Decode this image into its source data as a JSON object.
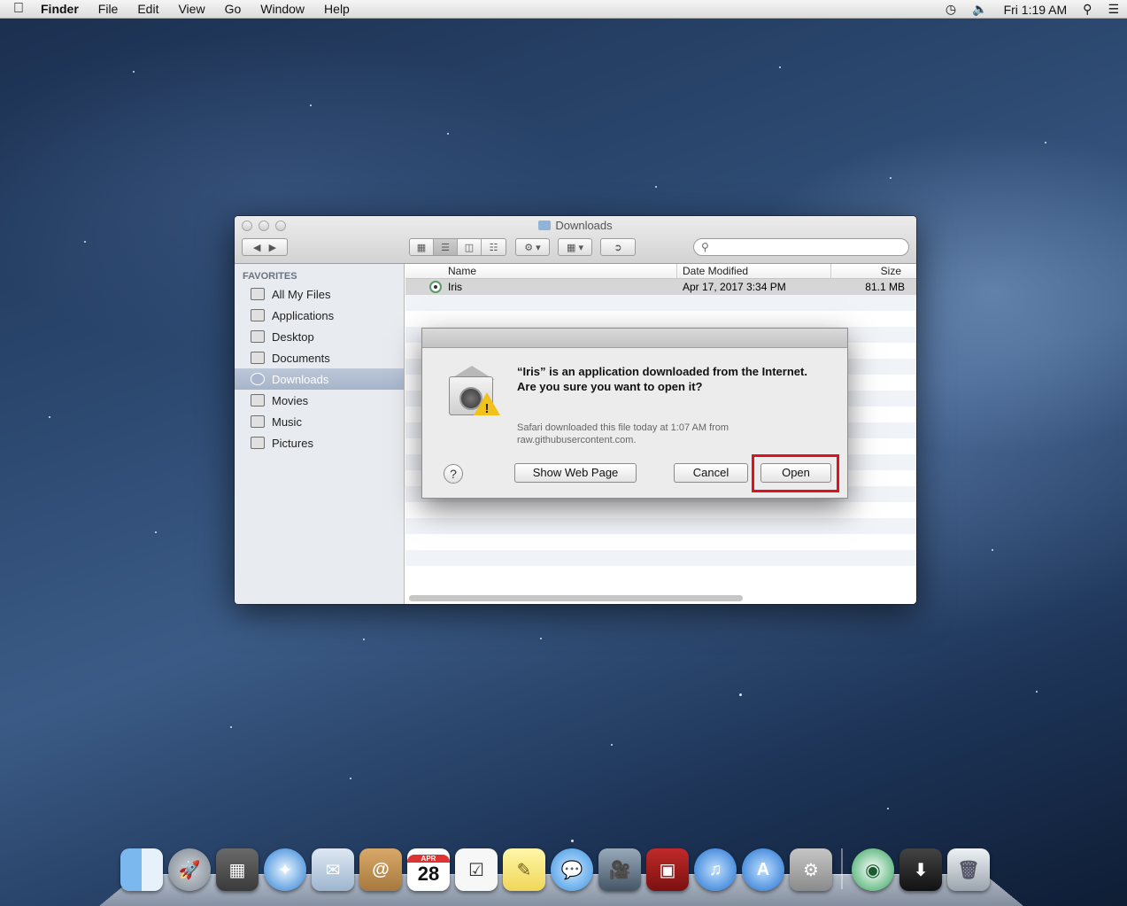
{
  "menubar": {
    "apple_icon": "apple-logo-icon",
    "app_name": "Finder",
    "menus": [
      "File",
      "Edit",
      "View",
      "Go",
      "Window",
      "Help"
    ],
    "clock": "Fri 1:19 AM",
    "status_icons": [
      "time-machine-icon",
      "volume-icon",
      "spotlight-icon",
      "notification-list-icon"
    ]
  },
  "finder": {
    "title": "Downloads",
    "sidebar": {
      "heading": "FAVORITES",
      "items": [
        {
          "label": "All My Files",
          "icon": "all-files-icon"
        },
        {
          "label": "Applications",
          "icon": "applications-icon"
        },
        {
          "label": "Desktop",
          "icon": "desktop-icon"
        },
        {
          "label": "Documents",
          "icon": "documents-icon"
        },
        {
          "label": "Downloads",
          "icon": "downloads-icon",
          "selected": true
        },
        {
          "label": "Movies",
          "icon": "movies-icon"
        },
        {
          "label": "Music",
          "icon": "music-icon"
        },
        {
          "label": "Pictures",
          "icon": "pictures-icon"
        }
      ]
    },
    "columns": {
      "name": "Name",
      "date": "Date Modified",
      "size": "Size"
    },
    "files": [
      {
        "name": "Iris",
        "date": "Apr 17, 2017 3:34 PM",
        "size": "81.1 MB"
      }
    ]
  },
  "dialog": {
    "message": "“Iris” is an application downloaded from the Internet. Are you sure you want to open it?",
    "detail": "Safari downloaded this file today at 1:07 AM from raw.githubusercontent.com.",
    "help_label": "?",
    "show_web_page": "Show Web Page",
    "cancel": "Cancel",
    "open": "Open",
    "highlight_color": "#e0101e"
  },
  "dock": {
    "apps": [
      "finder",
      "launchpad",
      "photo-browser",
      "safari",
      "mail",
      "contacts",
      "calendar",
      "reminders",
      "notes",
      "messages",
      "facetime",
      "photo-booth",
      "itunes",
      "app-store",
      "system-preferences",
      "iris",
      "downloads-stack",
      "trash"
    ],
    "calendar_month": "APR",
    "calendar_day": "28"
  }
}
